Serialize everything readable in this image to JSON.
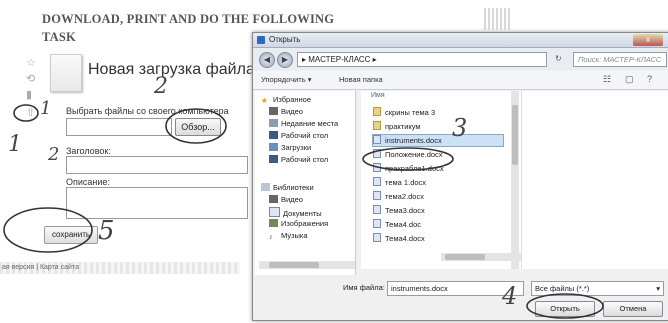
{
  "page_title": [
    "DOWNLOAD, PRINT AND DO THE FOLLOWING",
    "TASK"
  ],
  "upload": {
    "title": "Новая загрузка файла",
    "choose_label": "Выбрать файлы со своего компьютера",
    "browse_button": "Обзор...",
    "heading_label": "Заголовок:",
    "description_label": "Описание:",
    "save_button": "сохранить",
    "footer": "ая версия | Карта сайта"
  },
  "annotations": [
    "1",
    "2",
    "1",
    "2",
    "3",
    "4",
    "5"
  ],
  "dialog": {
    "title": "Открыть",
    "close": "x",
    "path": "▸ МАСТЕР-КЛАСС ▸",
    "search_placeholder": "Поиск: МАСТЕР-КЛАСС",
    "toolbar": {
      "organize": "Упорядочить ▾",
      "new_folder": "Новая папка"
    },
    "nav": [
      {
        "label": "Избранное",
        "icon": "star-icon"
      },
      {
        "label": "Видео",
        "icon": "video-icon"
      },
      {
        "label": "Недавние места",
        "icon": "recent-icon"
      },
      {
        "label": "Рабочий стол",
        "icon": "desktop-icon"
      },
      {
        "label": "Загрузки",
        "icon": "downloads-icon"
      },
      {
        "label": "Рабочий стол",
        "icon": "desktop-icon"
      },
      {
        "label": "Библиотеки",
        "icon": "library-icon"
      },
      {
        "label": "Видео",
        "icon": "video-icon"
      },
      {
        "label": "Документы",
        "icon": "documents-icon"
      },
      {
        "label": "Изображения",
        "icon": "images-icon"
      },
      {
        "label": "Музыка",
        "icon": "music-icon"
      }
    ],
    "column_header": "Имя",
    "files": [
      {
        "name": "скрины тема 3",
        "type": "folder"
      },
      {
        "name": "практикум",
        "type": "folder"
      },
      {
        "name": "instruments.docx",
        "type": "doc",
        "selected": true
      },
      {
        "name": "Положение.docx",
        "type": "doc"
      },
      {
        "name": "пракрабле1.docx",
        "type": "doc"
      },
      {
        "name": "тема 1.docx",
        "type": "doc"
      },
      {
        "name": "тема2.docx",
        "type": "doc"
      },
      {
        "name": "Тема3.docx",
        "type": "doc"
      },
      {
        "name": "Тема4.doc",
        "type": "doc"
      },
      {
        "name": "Тема4.docx",
        "type": "doc"
      }
    ],
    "filename_label": "Имя файла:",
    "filename_value": "instruments.docx",
    "filetype_value": "Все файлы (*.*)",
    "open_button": "Открыть",
    "cancel_button": "Отмена"
  }
}
